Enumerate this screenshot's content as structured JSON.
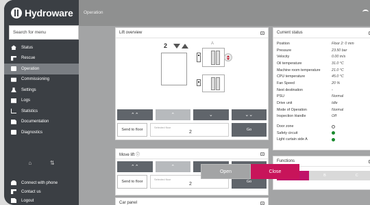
{
  "app": {
    "logo_text": "Hydroware",
    "page_title": "Operation"
  },
  "search": {
    "placeholder": "Search for menu"
  },
  "sidebar": {
    "items": [
      {
        "label": "Status",
        "icon": "home-icon"
      },
      {
        "label": "Rescue",
        "icon": "rescue-icon"
      },
      {
        "label": "Operation",
        "icon": "operation-icon",
        "active": true
      },
      {
        "label": "Commissioning",
        "icon": "commissioning-icon"
      },
      {
        "label": "Settings",
        "icon": "settings-icon"
      },
      {
        "label": "Logs",
        "icon": "logs-icon"
      },
      {
        "label": "Statistics",
        "icon": "statistics-icon"
      },
      {
        "label": "Documentation",
        "icon": "documentation-icon"
      },
      {
        "label": "Diagnostics",
        "icon": "diagnostics-icon"
      }
    ],
    "bottom_glyphs": {
      "home": "⌂",
      "sort": "⇅"
    },
    "bottom_items": [
      {
        "label": "Connect with phone",
        "icon": "wifi-icon"
      },
      {
        "label": "Contact us",
        "icon": "phone-icon"
      },
      {
        "label": "Logout",
        "icon": "logout-icon"
      }
    ]
  },
  "lift_overview": {
    "title": "Lift overview",
    "floor": "2",
    "shaft_label": "A",
    "nav_glyphs": [
      "⌃⌃",
      "⌃",
      "⌄",
      "⌄⌄"
    ],
    "send_label": "Send to floor",
    "selected_floor_placeholder": "Selected floor",
    "selected_floor_value": "2",
    "go_label": "Go"
  },
  "move_lift": {
    "title": "Move lift ⓘ",
    "nav_glyphs": [
      "⌃⌃",
      "⌃",
      "⌄",
      "⌄⌄"
    ],
    "send_label": "Send to floor",
    "selected_floor_placeholder": "Selected floor",
    "selected_floor_value": "2",
    "go_label": "Go"
  },
  "car_panel": {
    "title": "Car panel"
  },
  "current_status": {
    "title": "Current status",
    "rows": [
      {
        "label": "Position",
        "value": "Floor 2: 0 mm"
      },
      {
        "label": "Pressure",
        "value": "23.50 bar"
      },
      {
        "label": "Velocity",
        "value": "0.00 m/s"
      },
      {
        "label": "Oil temperature",
        "value": "31.0 °C"
      },
      {
        "label": "Machine room temperature",
        "value": "21.0 °C"
      },
      {
        "label": "CPU temperature",
        "value": "45.0 °C"
      },
      {
        "label": "Fan Speed",
        "value": "20 %"
      },
      {
        "label": "Next destination",
        "value": "-"
      },
      {
        "label": "PSU",
        "value": "Normal"
      },
      {
        "label": "Drive unit",
        "value": "Idle"
      },
      {
        "label": "Mode of Operation",
        "value": "Normal"
      },
      {
        "label": "Inspection Handle",
        "value": "Off"
      }
    ],
    "indicators": [
      {
        "label": "Door zone",
        "state": "off"
      },
      {
        "label": "Safety circuit",
        "state": "on"
      },
      {
        "label": "Light curtain side A",
        "state": "on"
      }
    ]
  },
  "functions": {
    "title": "Functions",
    "tabs": [
      "A",
      "B",
      "C"
    ],
    "active_tab": "A"
  },
  "doors": {
    "open_label": "Open",
    "close_label": "Close"
  },
  "colors": {
    "accent": "#c0146a",
    "sidebar_bg": "#3b3f44",
    "indicator_green": "#1a8a2e"
  }
}
